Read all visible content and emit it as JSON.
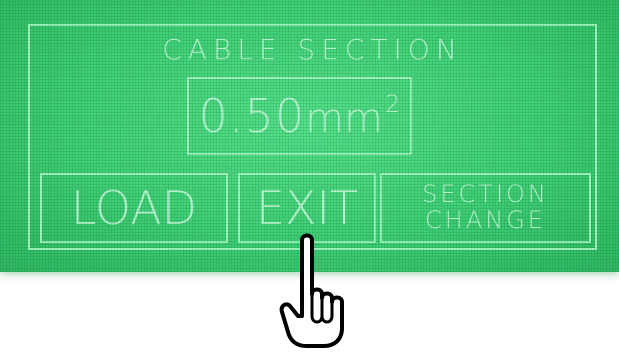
{
  "screen": {
    "title": "CABLE SECTION",
    "value_number": "0.50",
    "value_unit": "mm",
    "value_superscript": "2"
  },
  "buttons": {
    "load": "LOAD",
    "exit": "EXIT",
    "section_change_line1": "SECTION",
    "section_change_line2": "CHANGE"
  },
  "icons": {
    "pointer": "pointing-hand-icon"
  },
  "colors": {
    "lcd_background": "#3fcf76",
    "lcd_text": "#b6f7cf",
    "frame": "#9df5bd"
  }
}
